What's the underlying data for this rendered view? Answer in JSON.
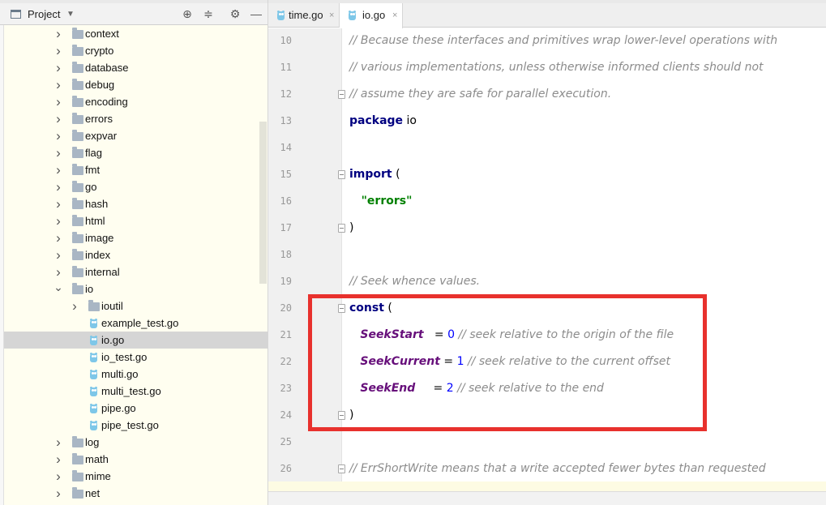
{
  "project_panel": {
    "title": "Project",
    "toolbar_icons": [
      "crosshair-icon",
      "collapse-all-icon",
      "gear-icon",
      "hide-panel-icon"
    ],
    "tree": [
      {
        "label": "context",
        "kind": "folder",
        "depth": 1,
        "expanded": false
      },
      {
        "label": "crypto",
        "kind": "folder",
        "depth": 1,
        "expanded": false
      },
      {
        "label": "database",
        "kind": "folder",
        "depth": 1,
        "expanded": false
      },
      {
        "label": "debug",
        "kind": "folder",
        "depth": 1,
        "expanded": false
      },
      {
        "label": "encoding",
        "kind": "folder",
        "depth": 1,
        "expanded": false
      },
      {
        "label": "errors",
        "kind": "folder",
        "depth": 1,
        "expanded": false
      },
      {
        "label": "expvar",
        "kind": "folder",
        "depth": 1,
        "expanded": false
      },
      {
        "label": "flag",
        "kind": "folder",
        "depth": 1,
        "expanded": false
      },
      {
        "label": "fmt",
        "kind": "folder",
        "depth": 1,
        "expanded": false
      },
      {
        "label": "go",
        "kind": "folder",
        "depth": 1,
        "expanded": false
      },
      {
        "label": "hash",
        "kind": "folder",
        "depth": 1,
        "expanded": false
      },
      {
        "label": "html",
        "kind": "folder",
        "depth": 1,
        "expanded": false
      },
      {
        "label": "image",
        "kind": "folder",
        "depth": 1,
        "expanded": false
      },
      {
        "label": "index",
        "kind": "folder",
        "depth": 1,
        "expanded": false
      },
      {
        "label": "internal",
        "kind": "folder",
        "depth": 1,
        "expanded": false
      },
      {
        "label": "io",
        "kind": "folder",
        "depth": 1,
        "expanded": true
      },
      {
        "label": "ioutil",
        "kind": "folder",
        "depth": 2,
        "expanded": false
      },
      {
        "label": "example_test.go",
        "kind": "gofile",
        "depth": 2
      },
      {
        "label": "io.go",
        "kind": "gofile",
        "depth": 2,
        "selected": true
      },
      {
        "label": "io_test.go",
        "kind": "gofile",
        "depth": 2
      },
      {
        "label": "multi.go",
        "kind": "gofile",
        "depth": 2
      },
      {
        "label": "multi_test.go",
        "kind": "gofile",
        "depth": 2
      },
      {
        "label": "pipe.go",
        "kind": "gofile",
        "depth": 2
      },
      {
        "label": "pipe_test.go",
        "kind": "gofile",
        "depth": 2
      },
      {
        "label": "log",
        "kind": "folder",
        "depth": 1,
        "expanded": false
      },
      {
        "label": "math",
        "kind": "folder",
        "depth": 1,
        "expanded": false
      },
      {
        "label": "mime",
        "kind": "folder",
        "depth": 1,
        "expanded": false
      },
      {
        "label": "net",
        "kind": "folder",
        "depth": 1,
        "expanded": false
      }
    ]
  },
  "editor": {
    "tabs": [
      {
        "label": "time.go",
        "active": false,
        "close": "×"
      },
      {
        "label": "io.go",
        "active": true,
        "close": "×"
      }
    ],
    "lines": [
      {
        "no": "10",
        "fold": false,
        "tokens": [
          {
            "t": "// Because these interfaces and primitives wrap lower-level operations with",
            "c": "c-comment"
          }
        ]
      },
      {
        "no": "11",
        "fold": false,
        "tokens": [
          {
            "t": "// various implementations, unless otherwise informed clients should not",
            "c": "c-comment"
          }
        ]
      },
      {
        "no": "12",
        "fold": true,
        "tokens": [
          {
            "t": "// assume they are safe for parallel execution.",
            "c": "c-comment"
          }
        ]
      },
      {
        "no": "13",
        "fold": false,
        "tokens": [
          {
            "t": "package",
            "c": "c-kw"
          },
          {
            "t": " io",
            "c": "c-plain"
          }
        ]
      },
      {
        "no": "14",
        "fold": false,
        "tokens": []
      },
      {
        "no": "15",
        "fold": true,
        "tokens": [
          {
            "t": "import",
            "c": "c-kw"
          },
          {
            "t": " (",
            "c": "c-plain"
          }
        ]
      },
      {
        "no": "16",
        "fold": false,
        "tokens": [
          {
            "t": "   \"errors\"",
            "c": "c-str"
          }
        ]
      },
      {
        "no": "17",
        "fold": true,
        "tokens": [
          {
            "t": ")",
            "c": "c-plain"
          }
        ]
      },
      {
        "no": "18",
        "fold": false,
        "tokens": []
      },
      {
        "no": "19",
        "fold": false,
        "tokens": [
          {
            "t": "// Seek whence values.",
            "c": "c-comment"
          }
        ]
      },
      {
        "no": "20",
        "fold": true,
        "tokens": [
          {
            "t": "const",
            "c": "c-kw"
          },
          {
            "t": " (",
            "c": "c-plain"
          }
        ]
      },
      {
        "no": "21",
        "fold": false,
        "tokens": [
          {
            "t": "   ",
            "c": "c-plain"
          },
          {
            "t": "SeekStart",
            "c": "c-const"
          },
          {
            "t": "   = ",
            "c": "c-plain"
          },
          {
            "t": "0",
            "c": "c-num"
          },
          {
            "t": " // seek relative to the origin of the file",
            "c": "c-comment"
          }
        ]
      },
      {
        "no": "22",
        "fold": false,
        "tokens": [
          {
            "t": "   ",
            "c": "c-plain"
          },
          {
            "t": "SeekCurrent",
            "c": "c-const"
          },
          {
            "t": " = ",
            "c": "c-plain"
          },
          {
            "t": "1",
            "c": "c-num"
          },
          {
            "t": " // seek relative to the current offset",
            "c": "c-comment"
          }
        ]
      },
      {
        "no": "23",
        "fold": false,
        "tokens": [
          {
            "t": "   ",
            "c": "c-plain"
          },
          {
            "t": "SeekEnd",
            "c": "c-const"
          },
          {
            "t": "     = ",
            "c": "c-plain"
          },
          {
            "t": "2",
            "c": "c-num"
          },
          {
            "t": " // seek relative to the end",
            "c": "c-comment"
          }
        ]
      },
      {
        "no": "24",
        "fold": true,
        "tokens": [
          {
            "t": ")",
            "c": "c-plain"
          }
        ]
      },
      {
        "no": "25",
        "fold": false,
        "tokens": []
      },
      {
        "no": "26",
        "fold": true,
        "tokens": [
          {
            "t": "// ErrShortWrite means that a write accepted fewer bytes than requested",
            "c": "c-comment"
          }
        ]
      }
    ]
  },
  "colors": {
    "tree_background": "#fffef0",
    "selection": "#d5d5d5",
    "highlight_box": "#e8312d",
    "keyword": "#000080",
    "string": "#008000",
    "constant": "#660e7a",
    "number": "#0000ff",
    "comment": "#8c8c8c"
  }
}
